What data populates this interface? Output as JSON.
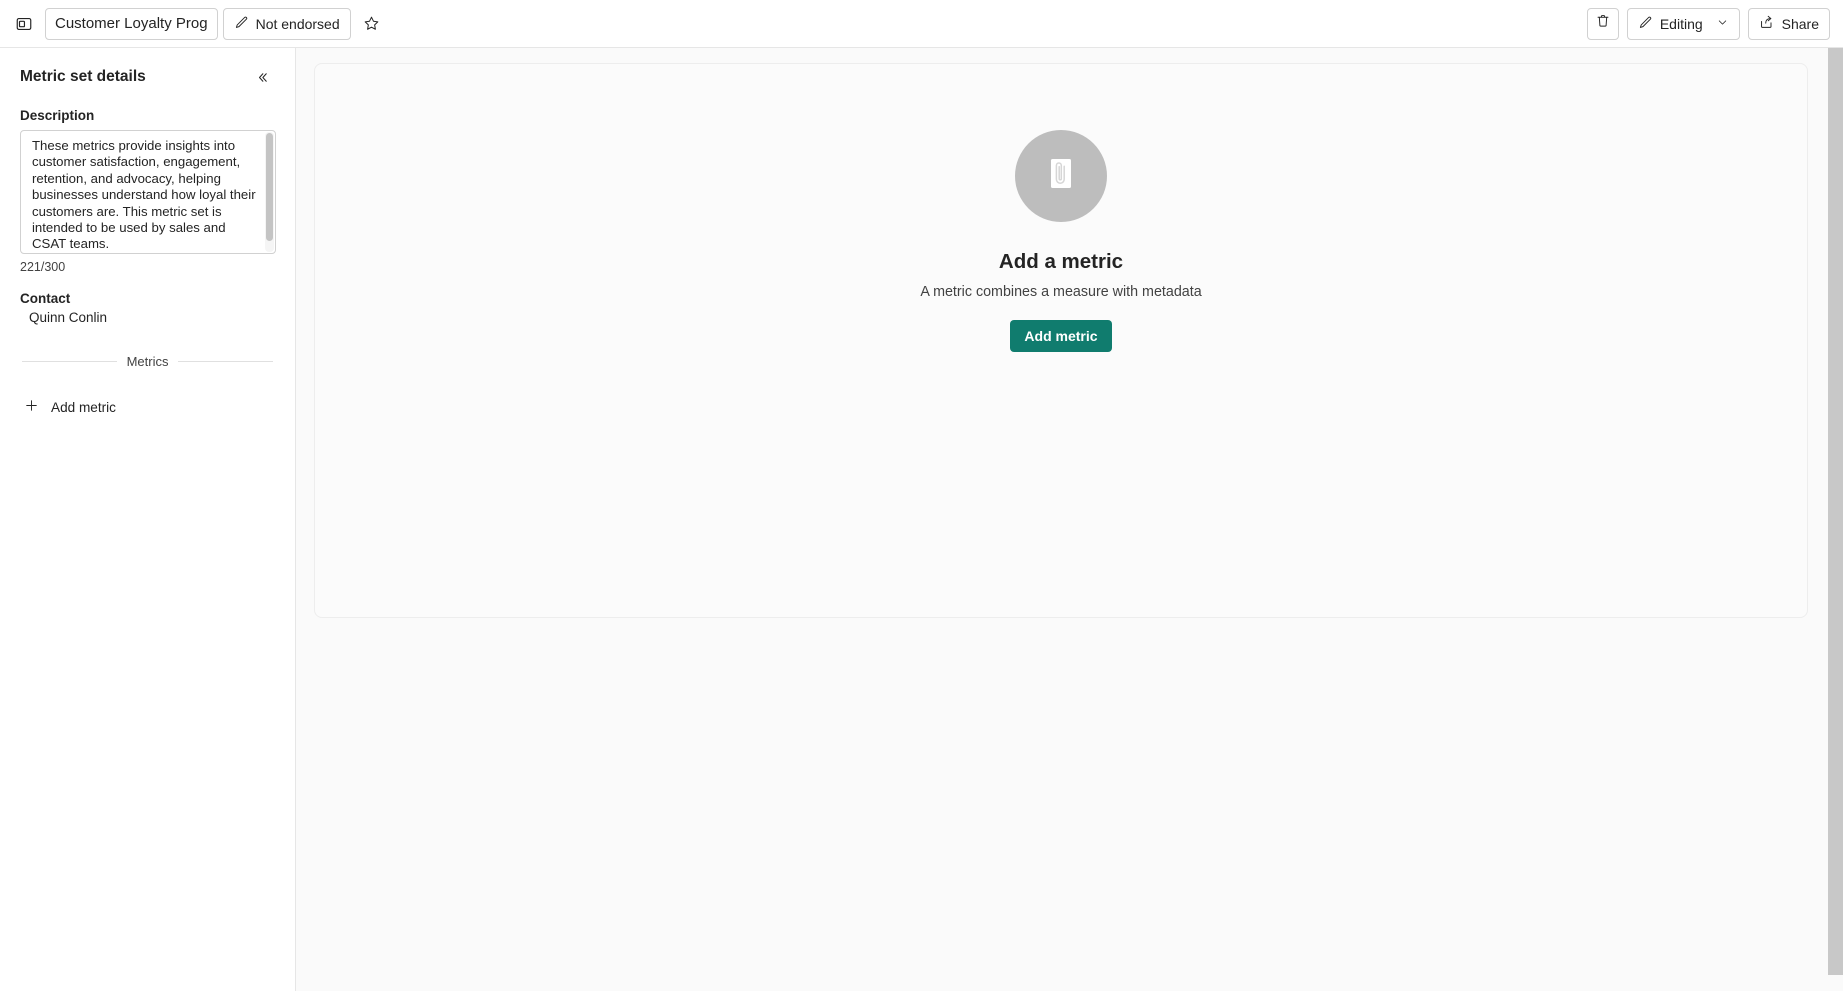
{
  "topbar": {
    "panel_toggle_icon": "panel-left-icon",
    "title_value": "Customer Loyalty Prog",
    "title_placeholder": "Metric set name",
    "endorse_label": "Not endorsed",
    "endorse_icon": "pencil-icon",
    "favorite_icon": "star-outline-icon",
    "delete_icon": "trash-icon",
    "mode_label": "Editing",
    "mode_icon": "pencil-icon",
    "mode_chevron_icon": "chevron-down-icon",
    "share_label": "Share",
    "share_icon": "share-icon"
  },
  "sidebar": {
    "title": "Metric set details",
    "collapse_icon": "chevron-double-left-icon",
    "description_label": "Description",
    "description_value": "These metrics provide insights into customer satisfaction, engagement, retention, and advocacy, helping businesses understand how loyal their customers are.  This metric set is intended to be used by sales and CSAT teams.",
    "description_placeholder": "Add a description",
    "char_count": "221/300",
    "contact_label": "Contact",
    "contact_value": "Quinn Conlin",
    "metrics_divider_label": "Metrics",
    "add_metric_label": "Add metric",
    "add_metric_icon": "plus-icon"
  },
  "main": {
    "empty_state": {
      "icon": "paperclip-document-icon",
      "title": "Add a metric",
      "subtitle": "A metric combines a measure with metadata",
      "button_label": "Add metric"
    }
  },
  "colors": {
    "accent_green": "#107c6e",
    "empty_circle": "#bdbdbd",
    "canvas": "#fafafa",
    "card": "#fbfbfb",
    "border": "#e6e6e6"
  }
}
